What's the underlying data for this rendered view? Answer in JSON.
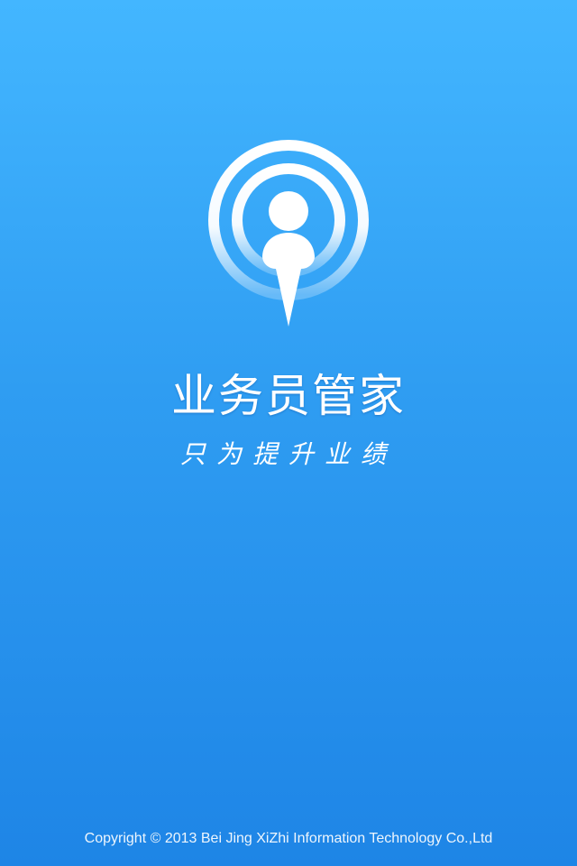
{
  "app": {
    "title": "业务员管家",
    "slogan": "只为提升业绩",
    "logo_icon": "user-location-pin-icon",
    "copyright": "Copyright © 2013 Bei Jing XiZhi Information Technology Co.,Ltd"
  },
  "colors": {
    "background_top": "#43b6ff",
    "background_bottom": "#1e85e6",
    "foreground": "#ffffff"
  }
}
